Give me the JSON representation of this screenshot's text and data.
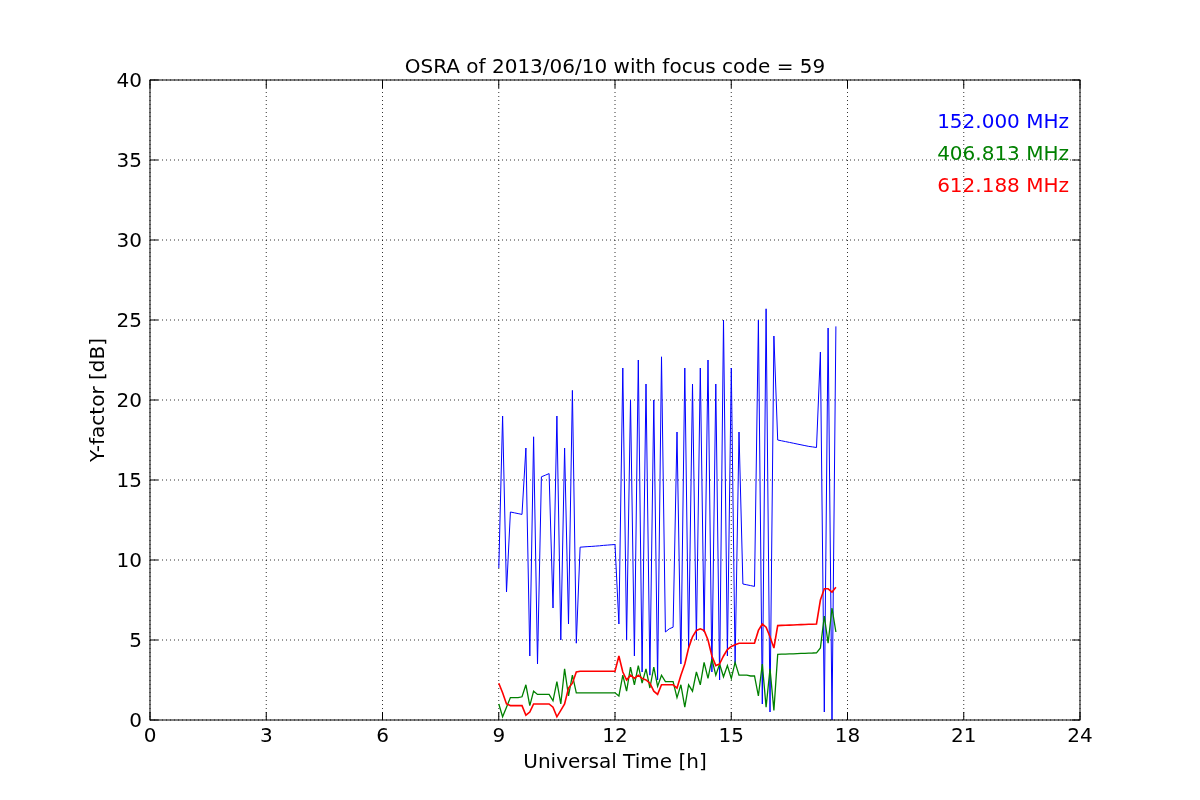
{
  "figure": {
    "chart_data": {
      "type": "line",
      "grid": true,
      "title": "OSRA of 2013/06/10 with focus code = 59",
      "xlabel": "Universal Time [h]",
      "ylabel": "Y-factor [dB]",
      "xlim": [
        0,
        24
      ],
      "ylim": [
        0,
        40
      ],
      "xticks": [
        0,
        3,
        6,
        9,
        12,
        15,
        18,
        21,
        24
      ],
      "yticks": [
        0,
        5,
        10,
        15,
        20,
        25,
        30,
        35,
        40
      ],
      "x": [
        9.0,
        9.1,
        9.2,
        9.3,
        9.4,
        9.5,
        9.6,
        9.7,
        9.8,
        9.9,
        10.0,
        10.1,
        10.2,
        10.3,
        10.4,
        10.5,
        10.6,
        10.7,
        10.8,
        10.9,
        11.0,
        11.1,
        11.2,
        11.3,
        11.4,
        11.5,
        11.6,
        11.7,
        11.8,
        11.9,
        12.0,
        12.1,
        12.2,
        12.3,
        12.4,
        12.5,
        12.6,
        12.7,
        12.8,
        12.9,
        13.0,
        13.1,
        13.2,
        13.3,
        13.4,
        13.5,
        13.6,
        13.7,
        13.8,
        13.9,
        14.0,
        14.1,
        14.2,
        14.3,
        14.4,
        14.5,
        14.6,
        14.7,
        14.8,
        14.9,
        15.0,
        15.1,
        15.2,
        15.3,
        15.4,
        15.5,
        15.6,
        15.7,
        15.8,
        15.9,
        16.0,
        16.1,
        16.2,
        16.3,
        16.4,
        16.5,
        16.6,
        16.7,
        16.8,
        16.9,
        17.0,
        17.1,
        17.2,
        17.3,
        17.4,
        17.5,
        17.6,
        17.7
      ],
      "series": [
        {
          "name": "152.000 MHz",
          "color": "#0000ff",
          "values": [
            9.5,
            19,
            8,
            13,
            12.95,
            12.9,
            12.85,
            17,
            4,
            17.7,
            3.5,
            15.2,
            15.3,
            15.4,
            7,
            19,
            5,
            17,
            6,
            20.6,
            4.8,
            10.8,
            10.82,
            10.84,
            10.85,
            10.87,
            10.89,
            10.91,
            10.93,
            10.95,
            10.97,
            6,
            22,
            5,
            20,
            4,
            22.5,
            3,
            21,
            2.8,
            20,
            2.5,
            22.7,
            5.5,
            5.7,
            5.8,
            18,
            3.5,
            22,
            4.5,
            21,
            5,
            22,
            5.5,
            22.5,
            3,
            21,
            2.5,
            25,
            4,
            22,
            3.5,
            18,
            8.5,
            8.45,
            8.4,
            8.35,
            25,
            1,
            25.7,
            0.5,
            24,
            17.5,
            17.45,
            17.4,
            17.35,
            17.3,
            17.25,
            17.2,
            17.15,
            17.1,
            17.07,
            17.03,
            23,
            0.5,
            24.5,
            0,
            24.6
          ]
        },
        {
          "name": "406.813 MHz",
          "color": "#008000",
          "values": [
            1,
            0.2,
            0.8,
            1.4,
            1.4,
            1.4,
            1.45,
            2.2,
            0.9,
            1.8,
            1.6,
            1.6,
            1.6,
            1.6,
            1.2,
            2.4,
            1.0,
            3.2,
            1.5,
            2.8,
            1.7,
            1.7,
            1.7,
            1.7,
            1.7,
            1.7,
            1.7,
            1.7,
            1.7,
            1.7,
            1.7,
            1.5,
            2.8,
            1.8,
            3.3,
            2.2,
            3.4,
            2.3,
            3.2,
            2.0,
            3.3,
            2.1,
            2.8,
            2.4,
            2.4,
            2.4,
            1.4,
            2.2,
            0.8,
            2.2,
            1.8,
            3.0,
            2.2,
            3.6,
            2.6,
            3.8,
            2.8,
            3.5,
            2.7,
            3.4,
            2.6,
            3.6,
            2.8,
            2.8,
            2.8,
            2.75,
            2.75,
            1.5,
            3.5,
            0.8,
            3.2,
            0.6,
            4.1,
            4.11,
            4.12,
            4.13,
            4.14,
            4.15,
            4.16,
            4.17,
            4.18,
            4.19,
            4.2,
            4.5,
            6.5,
            4.8,
            7,
            5.5
          ]
        },
        {
          "name": "612.188 MHz",
          "color": "#ff0000",
          "values": [
            2.3,
            1.7,
            1.0,
            0.9,
            0.9,
            0.9,
            0.9,
            0.3,
            0.5,
            1.0,
            1.0,
            1.0,
            1.0,
            1.0,
            0.8,
            0.2,
            0.6,
            1.0,
            2.0,
            2.3,
            3.0,
            3.05,
            3.05,
            3.05,
            3.05,
            3.05,
            3.05,
            3.05,
            3.05,
            3.05,
            3.05,
            4.0,
            3.0,
            2.5,
            2.8,
            2.6,
            2.8,
            2.6,
            2.5,
            2.3,
            1.8,
            1.6,
            2.2,
            2.2,
            2.2,
            2.2,
            2.0,
            2.8,
            3.5,
            4.5,
            5.2,
            5.6,
            5.7,
            5.6,
            5.0,
            4.0,
            3.4,
            3.5,
            4.0,
            4.4,
            4.6,
            4.7,
            4.8,
            4.8,
            4.8,
            4.8,
            4.8,
            5.6,
            6.0,
            5.8,
            5.2,
            4.5,
            5.9,
            5.91,
            5.92,
            5.93,
            5.94,
            5.95,
            5.96,
            5.97,
            5.98,
            5.99,
            6.0,
            7.5,
            8.2,
            8.2,
            8.0,
            8.3
          ]
        }
      ]
    }
  }
}
